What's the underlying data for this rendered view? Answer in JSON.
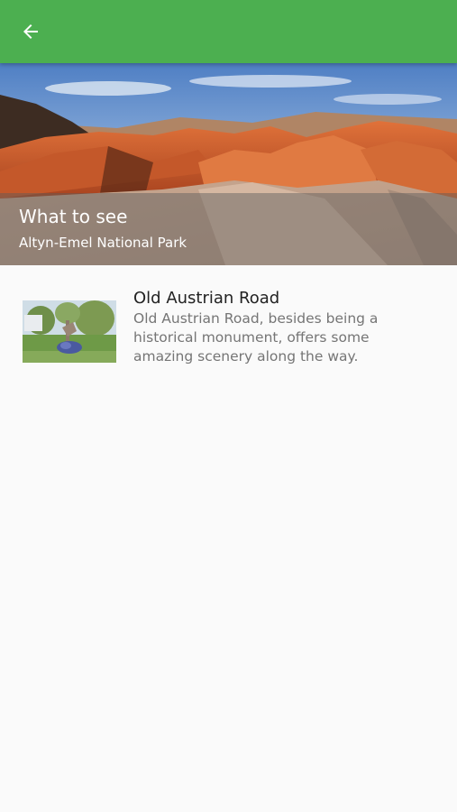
{
  "appbar": {
    "back_icon": "arrow-back-icon",
    "color": "#4caf50"
  },
  "hero": {
    "title": "What to see",
    "subtitle": "Altyn-Emel National Park"
  },
  "items": [
    {
      "title": "Old Austrian Road",
      "description": "Old Austrian Road, besides being a historical monument, offers some amazing scenery along the way."
    }
  ]
}
